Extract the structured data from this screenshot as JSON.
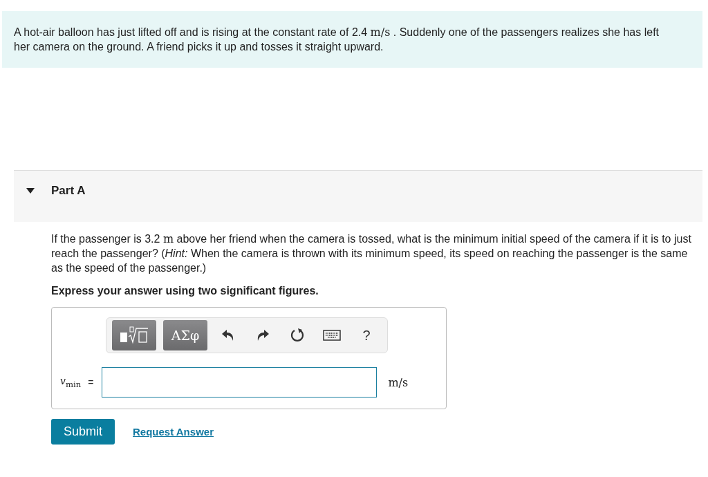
{
  "intro": [
    {
      "kind": "text",
      "text": "A hot-air balloon has just lifted off and is rising at the constant rate of 2.4 "
    },
    {
      "kind": "math",
      "text": "m/s"
    },
    {
      "kind": "text",
      "text": " . Suddenly one of the passengers realizes she has left her camera on the ground. A friend picks it up and tosses it straight upward."
    }
  ],
  "part": {
    "title": "Part A",
    "expanded": true,
    "question": [
      {
        "kind": "text",
        "text": "If the passenger is 3.2 "
      },
      {
        "kind": "math",
        "text": "m"
      },
      {
        "kind": "text",
        "text": " above her friend when the camera is tossed, what is the minimum initial speed of the camera if it is to just reach the passenger? ("
      },
      {
        "kind": "italic",
        "text": "Hint:"
      },
      {
        "kind": "text",
        "text": " When the camera is thrown with its minimum speed, its speed on reaching the passenger is the same as the speed of the passenger.)"
      }
    ],
    "instruction": "Express your answer using two significant figures.",
    "toolbar": [
      {
        "kind": "template"
      },
      {
        "kind": "greek",
        "text": "ΑΣφ"
      },
      {
        "kind": "undo"
      },
      {
        "kind": "redo"
      },
      {
        "kind": "reset"
      },
      {
        "kind": "keyboard"
      },
      {
        "kind": "help",
        "text": "?"
      }
    ],
    "variable": "*v*$_{min}$",
    "equals": "=",
    "unit": "m/s",
    "buttons": {
      "submit": "Submit",
      "request": "Request Answer"
    }
  }
}
